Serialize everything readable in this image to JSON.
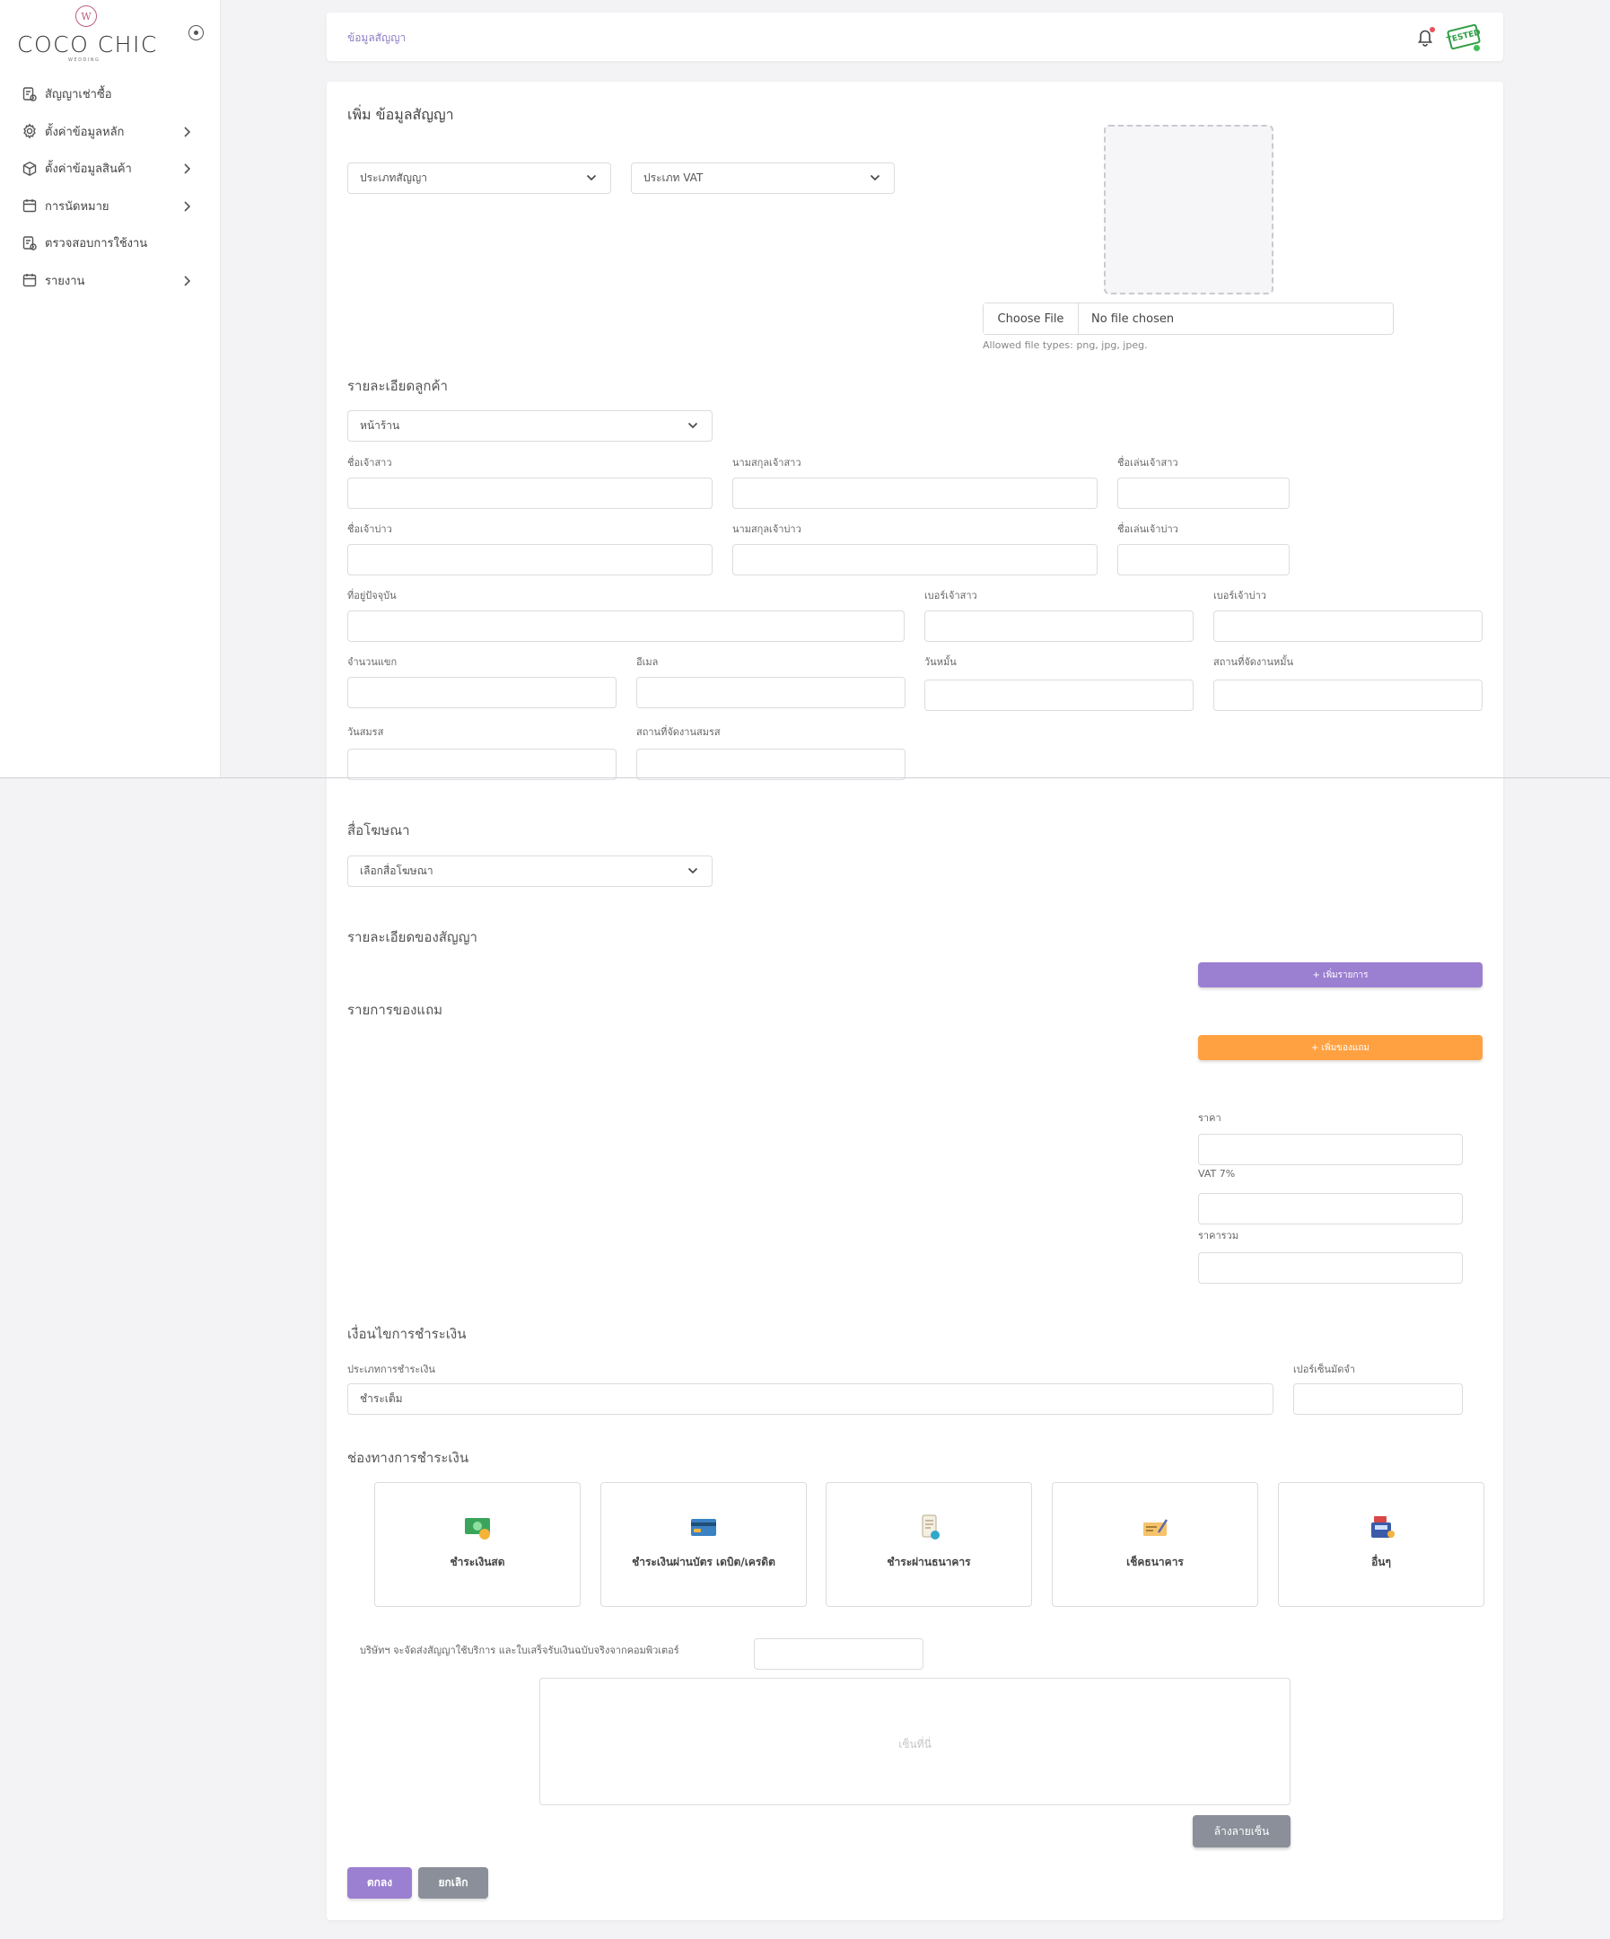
{
  "brand": {
    "mark": "W",
    "name": "COCO CHIC",
    "subtitle": "WEDDING"
  },
  "sidebar": {
    "items": [
      {
        "label": "สัญญาเช่าซื้อ",
        "icon": "contract-icon",
        "has_submenu": false
      },
      {
        "label": "ตั้งค่าข้อมูลหลัก",
        "icon": "gear-icon",
        "has_submenu": true
      },
      {
        "label": "ตั้งค่าข้อมูลสินค้า",
        "icon": "box-icon",
        "has_submenu": true
      },
      {
        "label": "การนัดหมาย",
        "icon": "calendar-icon",
        "has_submenu": true
      },
      {
        "label": "ตรวจสอบการใช้งาน",
        "icon": "audit-icon",
        "has_submenu": false
      },
      {
        "label": "รายงาน",
        "icon": "calendar-icon",
        "has_submenu": true
      }
    ]
  },
  "topbar": {
    "breadcrumb": "ข้อมูลสัญญา",
    "avatar_text": "TESTED"
  },
  "form": {
    "title": "เพิ่ม ข้อมูลสัญญา",
    "contract_type_select": "ประเภทสัญญา",
    "vat_type_select": "ประเภท VAT",
    "file": {
      "button": "Choose File",
      "status": "No file chosen",
      "hint": "Allowed file types: png, jpg, jpeg."
    },
    "customer": {
      "heading": "รายละเอียดลูกค้า",
      "branch_select": "หน้าร้าน",
      "bride_first_name": "ชื่อเจ้าสาว",
      "bride_last_name": "นามสกุลเจ้าสาว",
      "bride_nickname": "ชื่อเล่นเจ้าสาว",
      "groom_first_name": "ชื่อเจ้าบ่าว",
      "groom_last_name": "นามสกุลเจ้าบ่าว",
      "groom_nickname": "ชื่อเล่นเจ้าบ่าว",
      "address": "ที่อยู่ปัจจุบัน",
      "bride_phone": "เบอร์เจ้าสาว",
      "groom_phone": "เบอร์เจ้าบ่าว",
      "guest_count": "จำนวนแขก",
      "email": "อีเมล",
      "engagement_date": "วันหมั้น",
      "engagement_venue": "สถานที่จัดงานหมั้น",
      "wedding_date": "วันสมรส",
      "wedding_venue": "สถานที่จัดงานสมรส"
    },
    "media": {
      "heading": "สื่อโฆษณา",
      "select": "เลือกสื่อโฆษณา"
    },
    "contract_details": {
      "heading": "รายละเอียดของสัญญา",
      "add_item_button": "+ เพิ่มรายการ"
    },
    "gifts": {
      "heading": "รายการของแถม",
      "add_gift_button": "+ เพิ่มของแถม"
    },
    "totals": {
      "price": "ราคา",
      "vat": "VAT 7%",
      "grand_total": "ราคารวม"
    },
    "payment_terms": {
      "heading": "เงื่อนไขการชำระเงิน",
      "type_label": "ประเภทการชำระเงิน",
      "type_value": "ชำระเต็ม",
      "deposit_label": "เปอร์เซ็นมัดจำ"
    },
    "payment_channels": {
      "heading": "ช่องทางการชำระเงิน",
      "options": [
        {
          "label": "ชำระเงินสด",
          "icon": "cash-icon"
        },
        {
          "label": "ชำระเงินผ่านบัตร เดบิต/เครดิต",
          "icon": "credit-card-icon"
        },
        {
          "label": "ชำระผ่านธนาคาร",
          "icon": "bank-transfer-icon"
        },
        {
          "label": "เช็คธนาคาร",
          "icon": "cheque-icon"
        },
        {
          "label": "อื่นๆ",
          "icon": "cash-register-icon"
        }
      ]
    },
    "signature": {
      "notice": "บริษัทฯ จะจัดส่งสัญญาใช้บริการ และใบเสร็จรับเงินฉบับจริงจากคอมพิวเตอร์",
      "placeholder": "เซ็นที่นี่",
      "clear_button": "ล้างลายเซ็น"
    },
    "actions": {
      "confirm": "ตกลง",
      "cancel": "ยกเลิก"
    }
  },
  "colors": {
    "accent_purple": "#9b7fd0",
    "accent_orange": "#ffa140",
    "grey_button": "#8a8f99",
    "breadcrumb": "#8e7cc3"
  }
}
